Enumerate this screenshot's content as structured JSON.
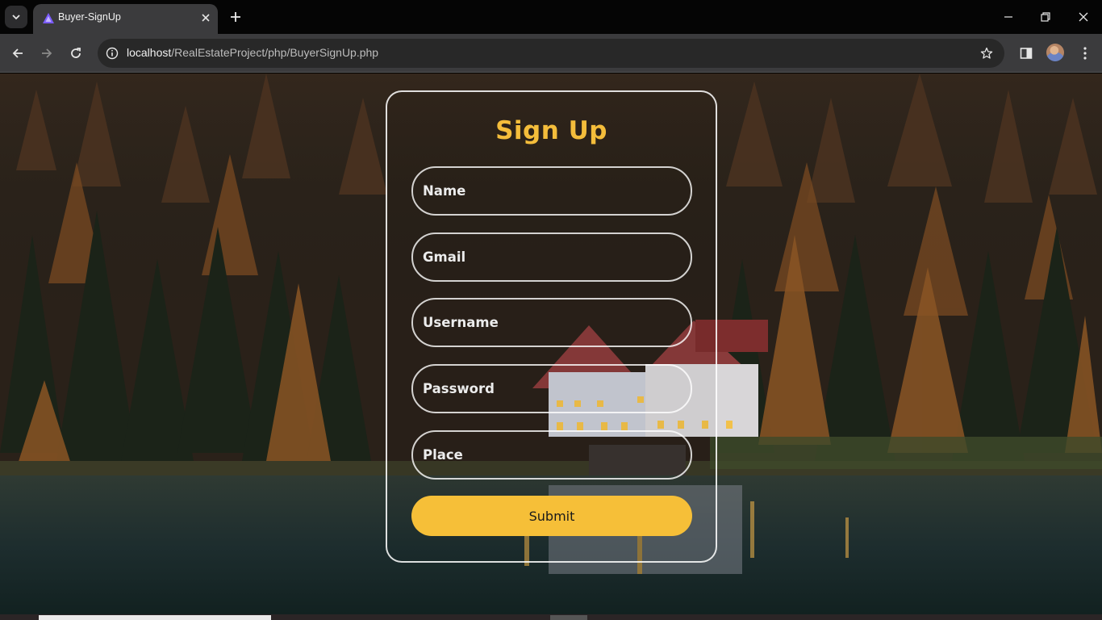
{
  "browser": {
    "tab_title": "Buyer-SignUp",
    "url_host": "localhost",
    "url_path": "/RealEstateProject/php/BuyerSignUp.php",
    "icons": {
      "tab_search": "chevron-down-icon",
      "favicon": "triangle-logo-icon",
      "tab_close": "close-icon",
      "new_tab": "plus-icon",
      "minimize": "minimize-icon",
      "restore": "restore-icon",
      "close_window": "close-icon",
      "back": "back-arrow-icon",
      "forward": "forward-arrow-icon",
      "reload": "reload-icon",
      "site_info": "info-icon",
      "bookmark": "star-icon",
      "side_panel": "side-panel-icon",
      "profile": "avatar",
      "menu": "kebab-menu-icon"
    }
  },
  "signup": {
    "title": "Sign Up",
    "fields": {
      "name": {
        "placeholder": "Name",
        "value": ""
      },
      "gmail": {
        "placeholder": "Gmail",
        "value": ""
      },
      "username": {
        "placeholder": "Username",
        "value": ""
      },
      "password": {
        "placeholder": "Password",
        "value": ""
      },
      "place": {
        "placeholder": "Place",
        "value": ""
      }
    },
    "submit_label": "Submit"
  },
  "colors": {
    "accent": "#f6bf38",
    "title": "#f4bd3b",
    "card_border": "#ffffff",
    "chrome_dark": "#050505",
    "chrome_toolbar": "#3b3b3d"
  }
}
